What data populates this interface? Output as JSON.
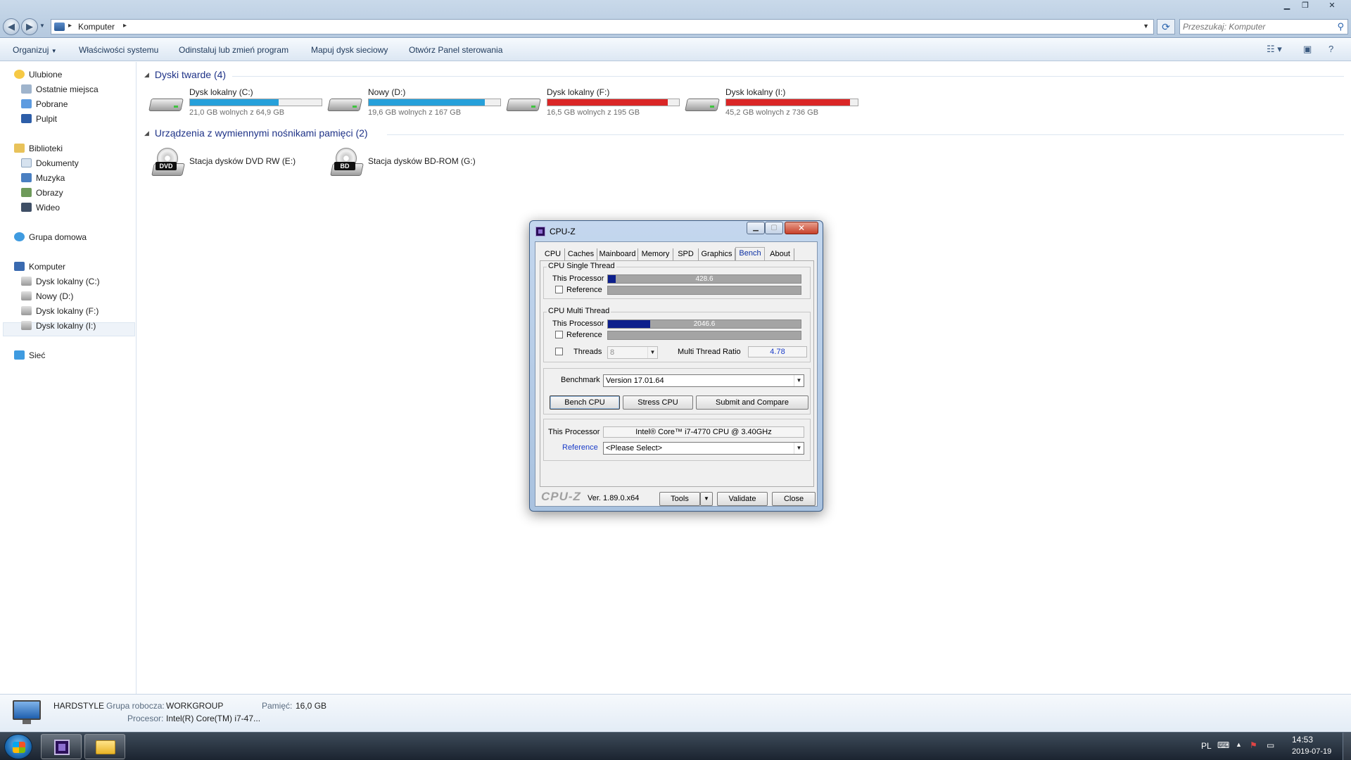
{
  "explorer": {
    "address": {
      "crumb": "Komputer"
    },
    "search": {
      "placeholder": "Przeszukaj: Komputer"
    },
    "toolbar": {
      "organize": "Organizuj",
      "system_properties": "Właściwości systemu",
      "uninstall": "Odinstaluj lub zmień program",
      "map_drive": "Mapuj dysk sieciowy",
      "control_panel": "Otwórz Panel sterowania"
    },
    "nav": {
      "favorites": "Ulubione",
      "recent": "Ostatnie miejsca",
      "downloads": "Pobrane",
      "desktop": "Pulpit",
      "libraries": "Biblioteki",
      "documents": "Dokumenty",
      "music": "Muzyka",
      "pictures": "Obrazy",
      "videos": "Wideo",
      "homegroup": "Grupa domowa",
      "computer": "Komputer",
      "drive_c": "Dysk lokalny (C:)",
      "drive_d": "Nowy (D:)",
      "drive_f": "Dysk lokalny (F:)",
      "drive_i": "Dysk lokalny (I:)",
      "network": "Sieć"
    },
    "groups": {
      "hard_drives": "Dyski twarde (4)",
      "removable": "Urządzenia z wymiennymi nośnikami pamięci (2)"
    },
    "drives": [
      {
        "name": "Dysk lokalny (C:)",
        "size": "21,0 GB wolnych z 64,9 GB",
        "used_fraction": 0.676,
        "bar_color": "#26a0da"
      },
      {
        "name": "Nowy (D:)",
        "size": "19,6 GB wolnych z 167 GB",
        "used_fraction": 0.883,
        "bar_color": "#26a0da"
      },
      {
        "name": "Dysk lokalny (F:)",
        "size": "16,5 GB wolnych z 195 GB",
        "used_fraction": 0.915,
        "bar_color": "#da2626"
      },
      {
        "name": "Dysk lokalny (I:)",
        "size": "45,2 GB wolnych z 736 GB",
        "used_fraction": 0.939,
        "bar_color": "#da2626"
      }
    ],
    "optical": [
      {
        "name": "Stacja dysków DVD RW (E:)",
        "label": "DVD"
      },
      {
        "name": "Stacja dysków BD-ROM (G:)",
        "label": "BD"
      }
    ],
    "details": {
      "computer_name": "HARDSTYLE",
      "workgroup_label": "Grupa robocza:",
      "workgroup": "WORKGROUP",
      "memory_label": "Pamięć:",
      "memory": "16,0 GB",
      "processor_label": "Procesor:",
      "processor": "Intel(R) Core(TM) i7-47..."
    }
  },
  "taskbar": {
    "lang": "PL",
    "time": "14:53",
    "date": "2019-07-19"
  },
  "cpuz": {
    "title": "CPU-Z",
    "tabs": [
      "CPU",
      "Caches",
      "Mainboard",
      "Memory",
      "SPD",
      "Graphics",
      "Bench",
      "About"
    ],
    "active_tab": "Bench",
    "single_thread": {
      "legend": "CPU Single Thread",
      "this_label": "This Processor",
      "score": "428.6",
      "score_fraction": 0.04,
      "ref_label": "Reference"
    },
    "multi_thread": {
      "legend": "CPU Multi Thread",
      "this_label": "This Processor",
      "score": "2046.6",
      "score_fraction": 0.22,
      "ref_label": "Reference",
      "threads_label": "Threads",
      "threads_value": "8",
      "ratio_label": "Multi Thread Ratio",
      "ratio": "4.78"
    },
    "benchmark_label": "Benchmark",
    "benchmark_version": "Version 17.01.64",
    "buttons": {
      "bench": "Bench CPU",
      "stress": "Stress CPU",
      "submit": "Submit and Compare",
      "tools": "Tools",
      "validate": "Validate",
      "close": "Close"
    },
    "this_processor_label": "This Processor",
    "this_processor": "Intel® Core™ i7-4770 CPU @ 3.40GHz",
    "reference_label": "Reference",
    "reference_value": "<Please Select>",
    "footer_logo": "CPU-Z",
    "version": "Ver. 1.89.0.x64"
  }
}
